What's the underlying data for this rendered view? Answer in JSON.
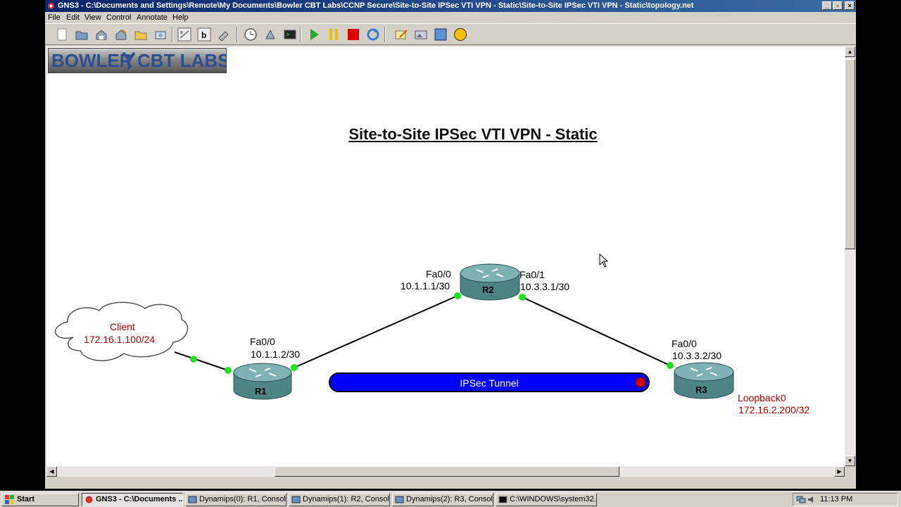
{
  "window": {
    "title": "GNS3 - C:\\Documents and Settings\\Remote\\My Documents\\Bowler CBT Labs\\CCNP Secure\\Site-to-Site IPSec VTI VPN - Static\\Site-to-Site IPSec VTI VPN - Static\\topology.net",
    "buttons": [
      "minimize",
      "restore",
      "close"
    ]
  },
  "menubar": {
    "items": [
      "File",
      "Edit",
      "View",
      "Control",
      "Annotate",
      "Help"
    ]
  },
  "toolbar": {
    "icons": [
      "new-file-icon",
      "open-folder-icon",
      "save-icon",
      "save-as-icon",
      "open-project-icon",
      "snapshot-icon",
      "interface-labels-icon",
      "hostname-labels-icon",
      "add-link-icon",
      "clock-icon",
      "idle-pc-icon",
      "console-all-icon",
      "start-all-icon",
      "suspend-all-icon",
      "stop-all-icon",
      "reload-all-icon",
      "add-note-icon",
      "insert-picture-icon",
      "draw-rectangle-icon",
      "draw-ellipse-icon"
    ],
    "colors": {
      "start": "#22aa22",
      "suspend": "#e8c000",
      "stop": "#dd0000",
      "rectangle": "#5b8fd6",
      "ellipse": "#f2c200"
    }
  },
  "logo": {
    "text_left": "BOWLER",
    "text_right": "CBT LABS"
  },
  "diagram": {
    "title": "Site-to-Site IPSec VTI VPN - Static",
    "client": {
      "name": "Client",
      "ip": "172.16.1.100/24"
    },
    "r1": {
      "name": "R1",
      "iface": "Fa0/0",
      "ip": "10.1.1.2/30"
    },
    "r2": {
      "name": "R2",
      "iface_left": "Fa0/0",
      "ip_left": "10.1.1.1/30",
      "iface_right": "Fa0/1",
      "ip_right": "10.3.3.1/30"
    },
    "r3": {
      "name": "R3",
      "iface": "Fa0/0",
      "ip": "10.3.3.2/30",
      "loopback_name": "Loopback0",
      "loopback_ip": "172.16.2.200/32"
    },
    "tunnel": {
      "label": "IPSec Tunnel",
      "color": "#0000ff"
    },
    "link_status_color": "#22e022",
    "router_color": "#5f9a9a"
  },
  "taskbar": {
    "start_label": "Start",
    "tasks": [
      {
        "label": "GNS3 - C:\\Documents ...",
        "active": true
      },
      {
        "label": "Dynamips(0): R1, Consol...",
        "active": false
      },
      {
        "label": "Dynamips(1): R2, Consol...",
        "active": false
      },
      {
        "label": "Dynamips(2): R3, Consol...",
        "active": false
      },
      {
        "label": "C:\\WINDOWS\\system32...",
        "active": false
      }
    ],
    "clock": "11:13 PM"
  }
}
